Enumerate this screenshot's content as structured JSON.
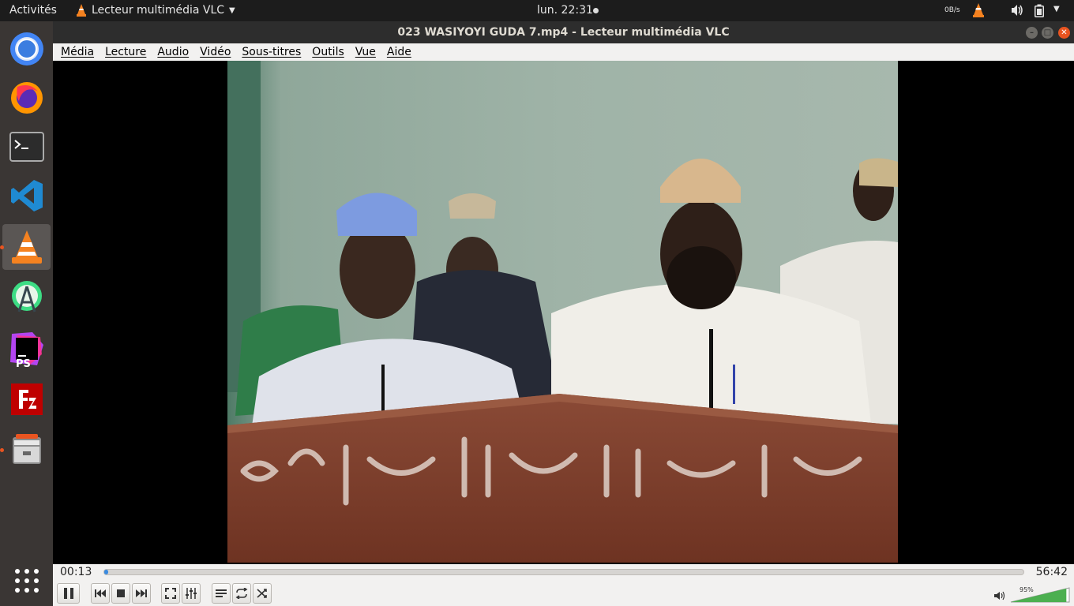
{
  "topbar": {
    "activities": "Activités",
    "app_name": "Lecteur multimédia VLC",
    "clock": "lun. 22:31",
    "net_speed": "0B/s"
  },
  "dock": {
    "items": [
      "chrome-icon",
      "firefox-icon",
      "terminal-icon",
      "vscode-icon",
      "vlc-icon",
      "android-studio-icon",
      "phpstorm-icon",
      "filezilla-icon",
      "files-icon"
    ],
    "show_apps_icon": "grid-icon"
  },
  "window": {
    "title": "023 WASIYOYI GUDA 7.mp4 - Lecteur multimédia VLC"
  },
  "menu": {
    "items": [
      "Média",
      "Lecture",
      "Audio",
      "Vidéo",
      "Sous-titres",
      "Outils",
      "Vue",
      "Aide"
    ]
  },
  "playback": {
    "elapsed": "00:13",
    "total": "56:42",
    "progress_fraction": 0.004,
    "volume_label": "95%",
    "volume_fraction": 0.95
  },
  "colors": {
    "accent": "#e95420",
    "seek_fill": "#3b8be0",
    "volume_fill": "#4caf50"
  }
}
